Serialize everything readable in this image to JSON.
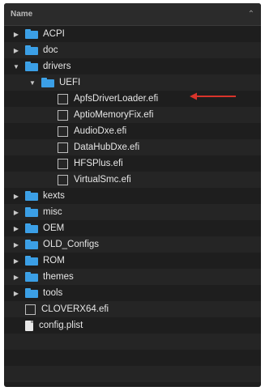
{
  "header": {
    "column_title": "Name",
    "sort_icon": "chevron-up-icon"
  },
  "rows": [
    {
      "name": "ACPI",
      "type": "folder",
      "level": 0,
      "disclosure": "collapsed"
    },
    {
      "name": "doc",
      "type": "folder",
      "level": 0,
      "disclosure": "collapsed"
    },
    {
      "name": "drivers",
      "type": "folder",
      "level": 0,
      "disclosure": "expanded"
    },
    {
      "name": "UEFI",
      "type": "folder",
      "level": 1,
      "disclosure": "expanded"
    },
    {
      "name": "ApfsDriverLoader.efi",
      "type": "efi",
      "level": 2,
      "disclosure": "none",
      "annotated": true
    },
    {
      "name": "AptioMemoryFix.efi",
      "type": "efi",
      "level": 2,
      "disclosure": "none"
    },
    {
      "name": "AudioDxe.efi",
      "type": "efi",
      "level": 2,
      "disclosure": "none"
    },
    {
      "name": "DataHubDxe.efi",
      "type": "efi",
      "level": 2,
      "disclosure": "none"
    },
    {
      "name": "HFSPlus.efi",
      "type": "efi",
      "level": 2,
      "disclosure": "none"
    },
    {
      "name": "VirtualSmc.efi",
      "type": "efi",
      "level": 2,
      "disclosure": "none"
    },
    {
      "name": "kexts",
      "type": "folder",
      "level": 0,
      "disclosure": "collapsed"
    },
    {
      "name": "misc",
      "type": "folder",
      "level": 0,
      "disclosure": "collapsed"
    },
    {
      "name": "OEM",
      "type": "folder",
      "level": 0,
      "disclosure": "collapsed"
    },
    {
      "name": "OLD_Configs",
      "type": "folder",
      "level": 0,
      "disclosure": "collapsed"
    },
    {
      "name": "ROM",
      "type": "folder",
      "level": 0,
      "disclosure": "collapsed"
    },
    {
      "name": "themes",
      "type": "folder",
      "level": 0,
      "disclosure": "collapsed"
    },
    {
      "name": "tools",
      "type": "folder",
      "level": 0,
      "disclosure": "collapsed"
    },
    {
      "name": "CLOVERX64.efi",
      "type": "efi",
      "level": 0,
      "disclosure": "none"
    },
    {
      "name": "config.plist",
      "type": "plist",
      "level": 0,
      "disclosure": "none"
    }
  ],
  "annotation": {
    "icon": "red-arrow-icon",
    "color": "#d9342b"
  },
  "colors": {
    "folder": "#3b9fe6",
    "background": "#1e1e1e",
    "text": "#e6e6e6"
  }
}
